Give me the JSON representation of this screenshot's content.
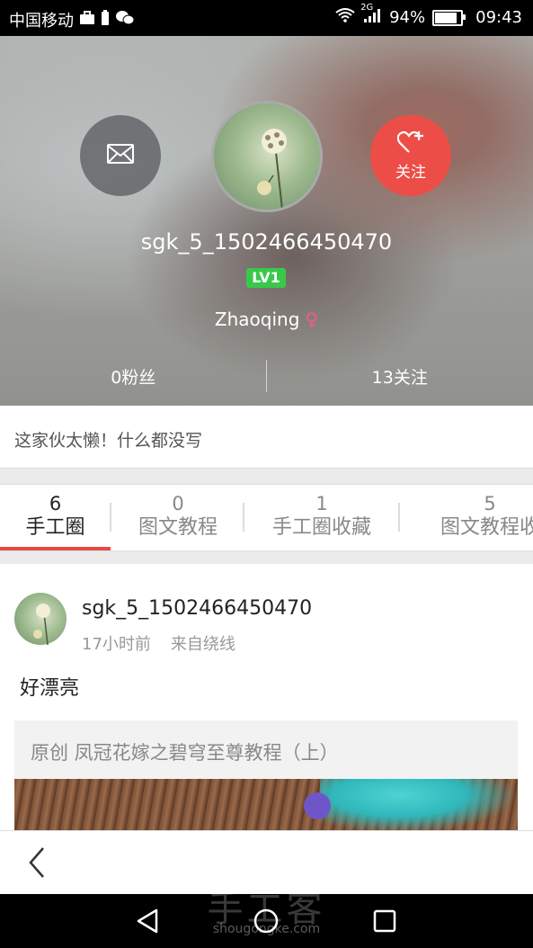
{
  "status_bar": {
    "carrier": "中国移动",
    "network": "2G",
    "battery": "94%",
    "battery_level": 0.94,
    "time": "09:43"
  },
  "profile": {
    "username": "sgk_5_1502466450470",
    "level_badge": "LV1",
    "location": "Zhaoqing",
    "gender_symbol": "♀",
    "followers": "0粉丝",
    "following": "13关注",
    "follow_label": "关注",
    "bio": "这家伙太懒！什么都没写"
  },
  "tabs": [
    {
      "count": "6",
      "label": "手工圈"
    },
    {
      "count": "0",
      "label": "图文教程"
    },
    {
      "count": "1",
      "label": "手工圈收藏"
    },
    {
      "count": "5",
      "label": "图文教程收"
    }
  ],
  "post": {
    "username": "sgk_5_1502466450470",
    "time": "17小时前",
    "source": "来自绕线",
    "text": "好漂亮",
    "shared_title": "原创 凤冠花嫁之碧穹至尊教程（上）"
  },
  "watermark": {
    "main": "手工客",
    "sub": "shougongke.com"
  },
  "colors": {
    "accent": "#e64a44",
    "follow_button": "#ec4e47",
    "level_badge": "#38c84a",
    "gender": "#f05a8c"
  }
}
